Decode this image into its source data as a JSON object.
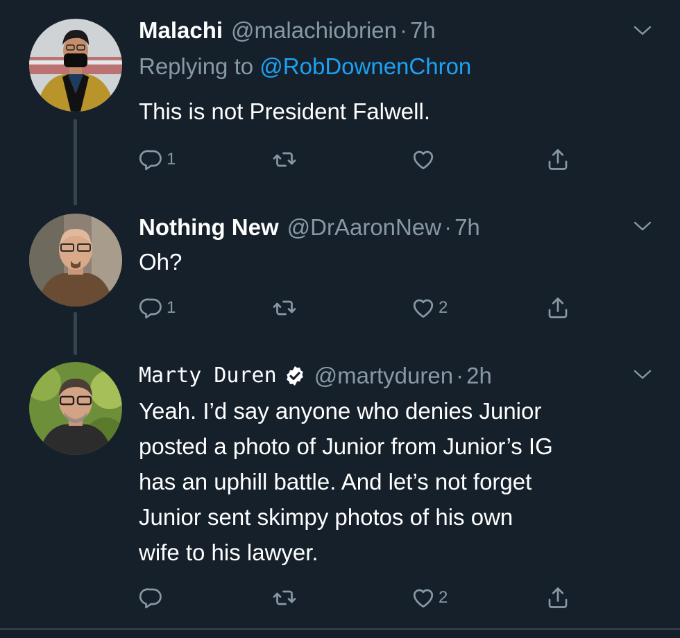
{
  "tweets": [
    {
      "display_name": "Malachi",
      "handle": "@malachiobrien",
      "separator": "·",
      "time": "7h",
      "replying_prefix": "Replying to",
      "replying_to": "@RobDownenChron",
      "text": "This is not President Falwell.",
      "reply_count": "1",
      "retweet_count": "",
      "like_count": "",
      "verified": false
    },
    {
      "display_name": "Nothing New",
      "handle": "@DrAaronNew",
      "separator": "·",
      "time": "7h",
      "text": "Oh?",
      "reply_count": "1",
      "retweet_count": "",
      "like_count": "2",
      "verified": false
    },
    {
      "display_name": "Marty Duren",
      "handle": "@martyduren",
      "separator": "·",
      "time": "2h",
      "text_lines": [
        "Yeah. I’d say anyone who denies Junior",
        "posted a photo of Junior from Junior’s IG",
        "has an uphill battle. And let’s not forget",
        "Junior sent skimpy photos of his own",
        "wife to his lawyer."
      ],
      "reply_count": "",
      "retweet_count": "",
      "like_count": "2",
      "verified": true
    }
  ],
  "icons": {
    "reply": "reply-icon",
    "retweet": "retweet-icon",
    "like": "heart-icon",
    "share": "share-icon",
    "more": "chevron-down-icon",
    "verified": "verified-badge-icon"
  },
  "colors": {
    "background": "#15202b",
    "text": "#ffffff",
    "secondary": "#8899a6",
    "link": "#1da1f2",
    "divider": "#38444d"
  }
}
